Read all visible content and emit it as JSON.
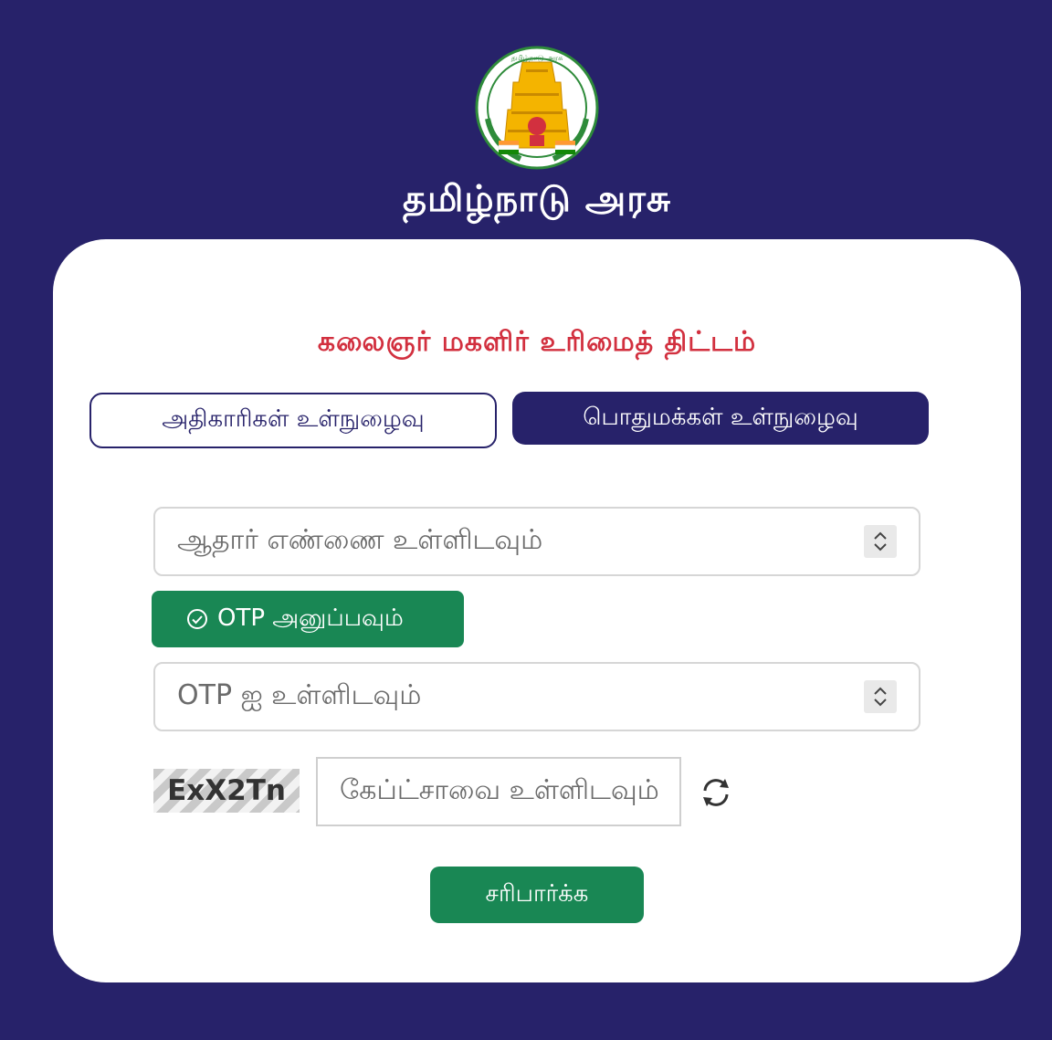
{
  "header": {
    "emblem_icon": "tamil-nadu-emblem-icon",
    "state_title": "தமிழ்நாடு அரசு",
    "emblem_text": "தமிழ்நாடு அரசு"
  },
  "card": {
    "scheme_title": "கலைஞர் மகளிர் உரிமைத் திட்டம்",
    "tabs": [
      {
        "label": "அதிகாரிகள் உள்நுழைவு",
        "active": false
      },
      {
        "label": "பொதுமக்கள் உள்நுழைவு",
        "active": true
      }
    ],
    "aadhaar_placeholder": "ஆதார் எண்ணை உள்ளிடவும்",
    "otp_button_label": "OTP அனுப்பவும்",
    "otp_placeholder": "OTP ஐ உள்ளிடவும்",
    "captcha_code": "ExX2Tn",
    "captcha_placeholder": "கேப்ட்சாவை உள்ளிடவும்",
    "verify_button_label": "சரிபார்க்க"
  },
  "colors": {
    "background": "#27226a",
    "title_red": "#d2303f",
    "button_green": "#198754"
  }
}
